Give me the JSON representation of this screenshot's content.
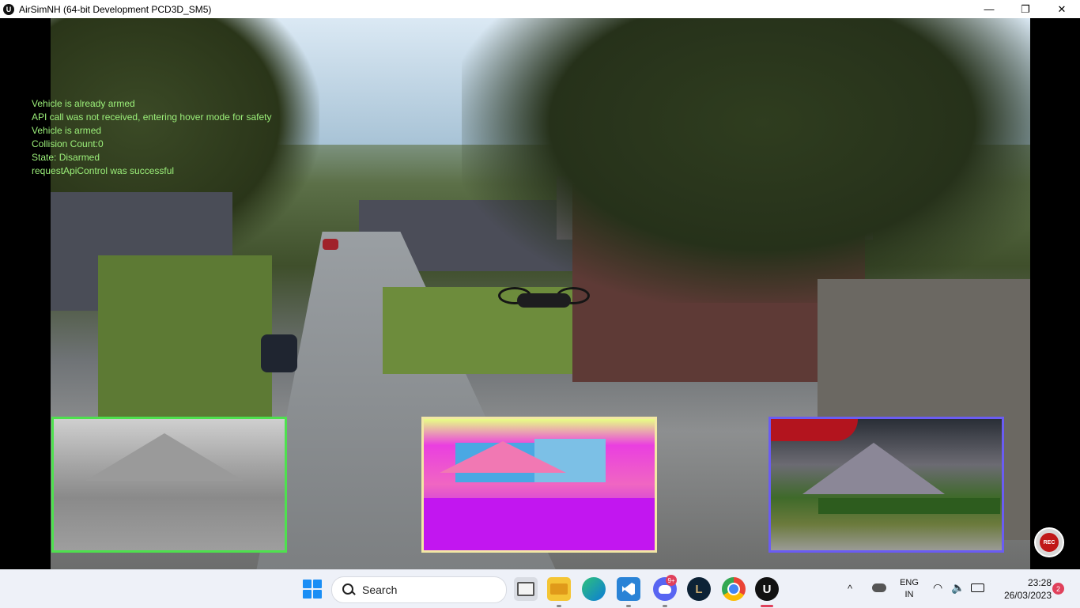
{
  "window": {
    "title": "AirSimNH (64-bit Development PCD3D_SM5)",
    "logo_glyph": "U",
    "controls": {
      "minimize": "—",
      "restore": "❐",
      "close": "✕"
    }
  },
  "log_messages": [
    "Vehicle is already armed",
    "API call was not received, entering hover mode for safety",
    "Vehicle is armed",
    "Collision Count:0",
    "State: Disarmed",
    "requestApiControl was successful"
  ],
  "subwindows": {
    "depth_border": "#4ee14e",
    "segmentation_border": "#f3e8a4",
    "scene_border": "#6a5cf3"
  },
  "rec_button": {
    "label": "REC"
  },
  "taskbar": {
    "search_label": "Search",
    "discord_badge": "9+",
    "apps": [
      "task-view",
      "file-explorer",
      "edge",
      "vscode",
      "discord",
      "league",
      "chrome",
      "unreal-engine"
    ],
    "tray": {
      "chevron": "^",
      "lang_line1": "ENG",
      "lang_line2": "IN",
      "wifi": "◠",
      "volume": "🔈",
      "time": "23:28",
      "date": "26/03/2023",
      "notifications": "2"
    }
  }
}
